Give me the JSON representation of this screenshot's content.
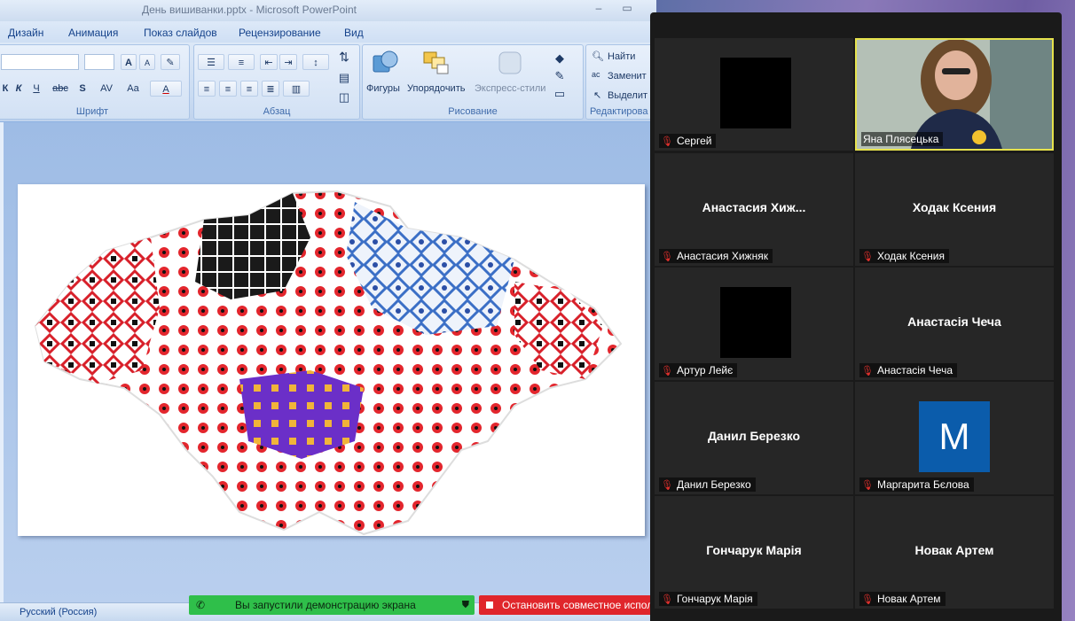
{
  "window": {
    "title": "День вишиванки.pptx - Microsoft PowerPoint",
    "min": "–",
    "max": "▭"
  },
  "menu_tabs": [
    "Дизайн",
    "Анимация",
    "Показ слайдов",
    "Рецензирование",
    "Вид"
  ],
  "ribbon": {
    "font": {
      "label": "Шрифт",
      "grow": "A",
      "shrink": "A",
      "italic": "К",
      "underline": "Ч",
      "strike": "abc",
      "shadow": "S",
      "spacing": "AV",
      "case": "Aa",
      "color": "A"
    },
    "paragraph": {
      "label": "Абзац"
    },
    "drawing": {
      "label": "Рисование",
      "shapes": "Фигуры",
      "arrange": "Упорядочить",
      "quick_styles": "Экспресс-стили"
    },
    "editing": {
      "label": "Редактирова",
      "find": "Найти",
      "replace": "Заменит",
      "select": "Выделит"
    }
  },
  "status": {
    "language": "Русский (Россия)"
  },
  "share_bar": {
    "started": "Вы запустили демонстрацию экрана",
    "stop": "Остановить совместное испол"
  },
  "participants": [
    {
      "name": "Сергей",
      "display": "",
      "kind": "black"
    },
    {
      "name": "Яна Плясецька",
      "display": "",
      "kind": "video"
    },
    {
      "name": "Анастасия Хижняк",
      "display": "Анастасия  Хиж...",
      "kind": "text"
    },
    {
      "name": "Ходак Ксения",
      "display": "Ходак Ксения",
      "kind": "text"
    },
    {
      "name": "Артур Лейє",
      "display": "",
      "kind": "black"
    },
    {
      "name": "Анастасія Чеча",
      "display": "Анастасія Чеча",
      "kind": "text"
    },
    {
      "name": "Данил Березко",
      "display": "Данил Березко",
      "kind": "text"
    },
    {
      "name": "Маргарита Бєлова",
      "display": "M",
      "kind": "avatar"
    },
    {
      "name": "Гончарук Марія",
      "display": "Гончарук Марія",
      "kind": "text"
    },
    {
      "name": "Новак Артем",
      "display": "Новак Артем",
      "kind": "text"
    }
  ],
  "colors": {
    "ribbon_text": "#15428b",
    "share_green": "#2fbf4a",
    "share_red": "#e0262b",
    "active_speaker": "#e6e24d",
    "avatar_blue": "#0b5cab",
    "muted_red": "#e0302c"
  }
}
